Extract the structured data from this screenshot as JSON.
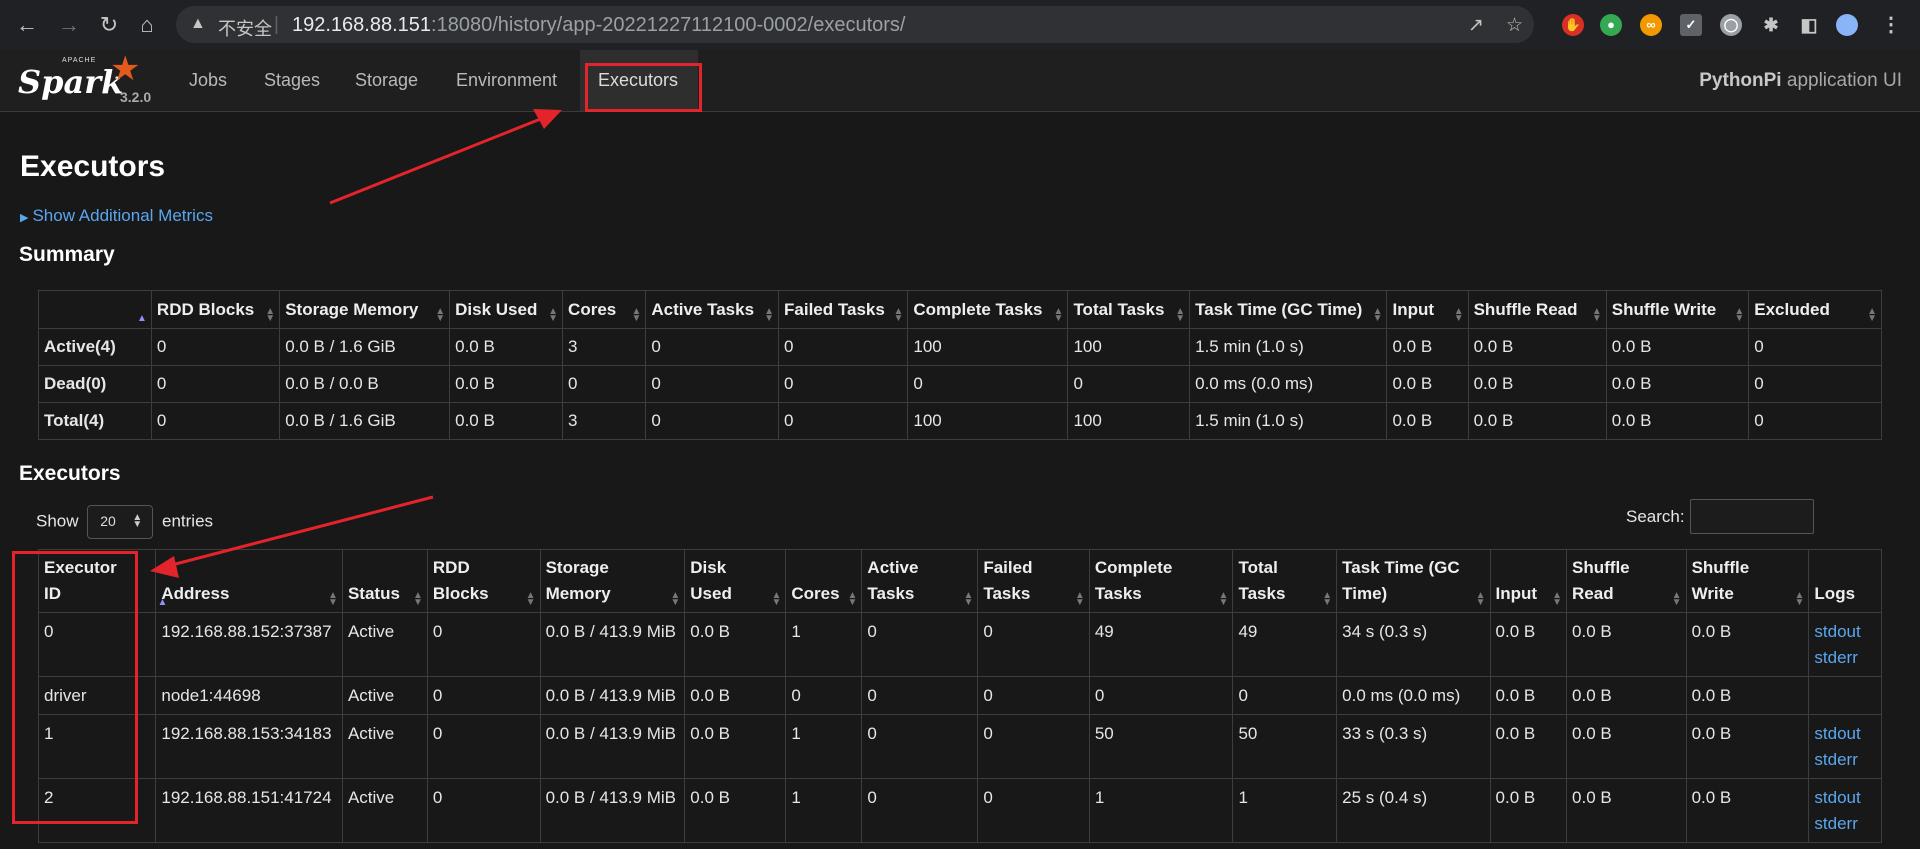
{
  "browser": {
    "security_label": "不安全",
    "url_host": "192.168.88.151",
    "url_path": ":18080/history/app-20221227112100-0002/executors/"
  },
  "spark": {
    "logo_text": "Spark",
    "logo_apache": "APACHE",
    "version": "3.2.0",
    "tabs": [
      "Jobs",
      "Stages",
      "Storage",
      "Environment",
      "Executors"
    ],
    "active_tab": "Executors",
    "app_name": "PythonPi",
    "app_suffix": " application UI"
  },
  "page": {
    "title": "Executors",
    "additional_metrics": "Show Additional Metrics",
    "summary_heading": "Summary",
    "executors_heading": "Executors"
  },
  "summary": {
    "headers": [
      "",
      "RDD Blocks",
      "Storage Memory",
      "Disk Used",
      "Cores",
      "Active Tasks",
      "Failed Tasks",
      "Complete Tasks",
      "Total Tasks",
      "Task Time (GC Time)",
      "Input",
      "Shuffle Read",
      "Shuffle Write",
      "Excluded"
    ],
    "rows": [
      [
        "Active(4)",
        "0",
        "0.0 B / 1.6 GiB",
        "0.0 B",
        "3",
        "0",
        "0",
        "100",
        "100",
        "1.5 min (1.0 s)",
        "0.0 B",
        "0.0 B",
        "0.0 B",
        "0"
      ],
      [
        "Dead(0)",
        "0",
        "0.0 B / 0.0 B",
        "0.0 B",
        "0",
        "0",
        "0",
        "0",
        "0",
        "0.0 ms (0.0 ms)",
        "0.0 B",
        "0.0 B",
        "0.0 B",
        "0"
      ],
      [
        "Total(4)",
        "0",
        "0.0 B / 1.6 GiB",
        "0.0 B",
        "3",
        "0",
        "0",
        "100",
        "100",
        "1.5 min (1.0 s)",
        "0.0 B",
        "0.0 B",
        "0.0 B",
        "0"
      ]
    ]
  },
  "executors_table": {
    "show_label": "Show",
    "page_size": "20",
    "entries_label": "entries",
    "search_label": "Search:",
    "headers": [
      [
        "Executor",
        "ID"
      ],
      [
        "",
        "Address"
      ],
      [
        "",
        "Status"
      ],
      [
        "RDD",
        "Blocks"
      ],
      [
        "Storage",
        "Memory"
      ],
      [
        "Disk",
        "Used"
      ],
      [
        "",
        "Cores"
      ],
      [
        "Active",
        "Tasks"
      ],
      [
        "Failed",
        "Tasks"
      ],
      [
        "Complete",
        "Tasks"
      ],
      [
        "Total",
        "Tasks"
      ],
      [
        "Task Time (GC",
        "Time)"
      ],
      [
        "",
        "Input"
      ],
      [
        "Shuffle",
        "Read"
      ],
      [
        "Shuffle",
        "Write"
      ],
      [
        "",
        "Logs"
      ]
    ],
    "rows": [
      {
        "cells": [
          "0",
          "192.168.88.152:37387",
          "Active",
          "0",
          "0.0 B / 413.9 MiB",
          "0.0 B",
          "1",
          "0",
          "0",
          "49",
          "49",
          "34 s (0.3 s)",
          "0.0 B",
          "0.0 B",
          "0.0 B"
        ],
        "logs": [
          "stdout",
          "stderr"
        ]
      },
      {
        "cells": [
          "driver",
          "node1:44698",
          "Active",
          "0",
          "0.0 B / 413.9 MiB",
          "0.0 B",
          "0",
          "0",
          "0",
          "0",
          "0",
          "0.0 ms (0.0 ms)",
          "0.0 B",
          "0.0 B",
          "0.0 B"
        ],
        "logs": []
      },
      {
        "cells": [
          "1",
          "192.168.88.153:34183",
          "Active",
          "0",
          "0.0 B / 413.9 MiB",
          "0.0 B",
          "1",
          "0",
          "0",
          "50",
          "50",
          "33 s (0.3 s)",
          "0.0 B",
          "0.0 B",
          "0.0 B"
        ],
        "logs": [
          "stdout",
          "stderr"
        ]
      },
      {
        "cells": [
          "2",
          "192.168.88.151:41724",
          "Active",
          "0",
          "0.0 B / 413.9 MiB",
          "0.0 B",
          "1",
          "0",
          "0",
          "1",
          "1",
          "25 s (0.4 s)",
          "0.0 B",
          "0.0 B",
          "0.0 B"
        ],
        "logs": [
          "stdout",
          "stderr"
        ]
      }
    ]
  },
  "colors": {
    "link": "#5aa6f0",
    "annotation_red": "#e3242b",
    "spark_orange": "#e25a1c"
  }
}
